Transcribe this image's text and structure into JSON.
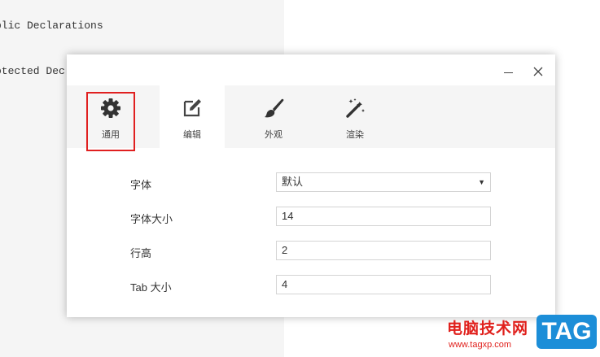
{
  "editor": {
    "lines": [
      "blic Declarations",
      ":",
      "otected Dec"
    ]
  },
  "dialog": {
    "minimize_glyph": "—",
    "close_glyph": "✕",
    "tabs": [
      {
        "label": "通用",
        "icon": "gear-icon",
        "active": true
      },
      {
        "label": "编辑",
        "icon": "edit-icon",
        "active": false
      },
      {
        "label": "外观",
        "icon": "brush-icon",
        "active": false
      },
      {
        "label": "渲染",
        "icon": "magic-wand-icon",
        "active": false
      }
    ],
    "settings": {
      "font_label": "字体",
      "font_value": "默认",
      "font_size_label": "字体大小",
      "font_size_value": "14",
      "line_height_label": "行高",
      "line_height_value": "2",
      "tab_size_label": "Tab 大小",
      "tab_size_value": "4"
    }
  },
  "watermark": {
    "title": "电脑技术网",
    "url": "www.tagxp.com",
    "badge": "TAG"
  },
  "colors": {
    "highlight_border": "#e02020",
    "badge_bg": "#1c8ed8",
    "watermark_red": "#e0201c"
  }
}
